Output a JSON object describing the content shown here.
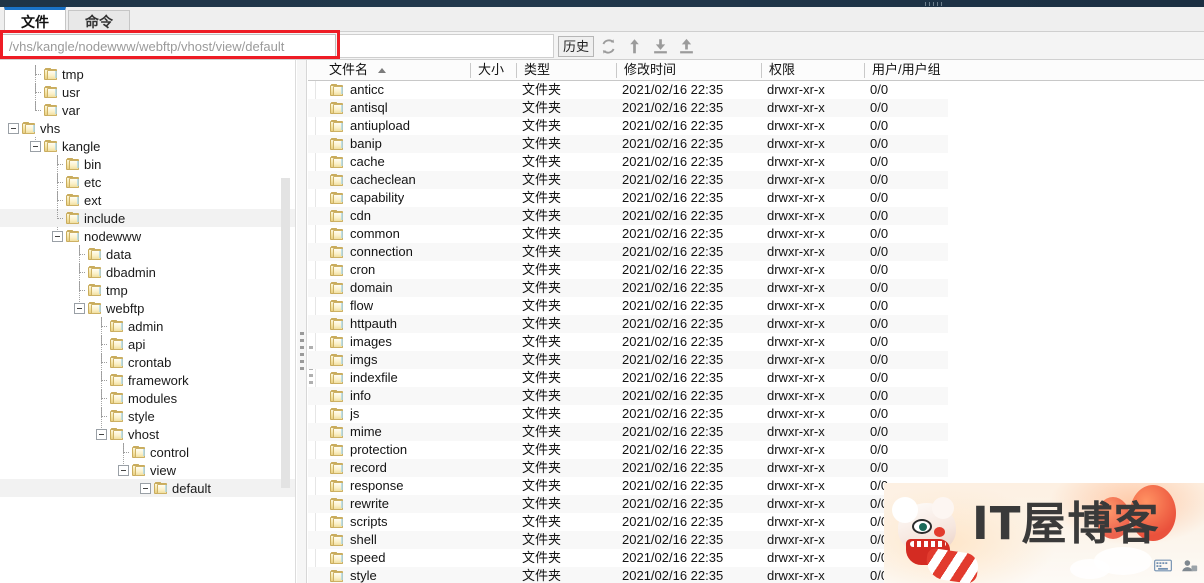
{
  "window": {
    "tabs": [
      {
        "label": "文件",
        "active": true,
        "name": "tab-files"
      },
      {
        "label": "命令",
        "active": false,
        "name": "tab-commands"
      }
    ]
  },
  "toolbar": {
    "path_value": "/vhs/kangle/nodewww/webftp/vhost/view/default",
    "path_placeholder": "/vhs/kangle/nodewww/webftp/vhost/view/default",
    "search_value": "",
    "history_label": "历史",
    "icons": [
      {
        "name": "refresh-icon",
        "title": "刷新"
      },
      {
        "name": "parent-directory-icon",
        "title": "上级目录"
      },
      {
        "name": "download-icon",
        "title": "下载"
      },
      {
        "name": "upload-icon",
        "title": "上传"
      }
    ],
    "highlight_color": "#ee1c25"
  },
  "tree": {
    "nodes": [
      {
        "label": "tmp",
        "depth": 1,
        "toggle": "none",
        "selected": false
      },
      {
        "label": "usr",
        "depth": 1,
        "toggle": "none",
        "selected": false
      },
      {
        "label": "var",
        "depth": 1,
        "toggle": "none",
        "selected": false
      },
      {
        "label": "vhs",
        "depth": 0,
        "toggle": "expanded",
        "selected": false
      },
      {
        "label": "kangle",
        "depth": 1,
        "toggle": "expanded",
        "selected": false
      },
      {
        "label": "bin",
        "depth": 2,
        "toggle": "none",
        "selected": false
      },
      {
        "label": "etc",
        "depth": 2,
        "toggle": "none",
        "selected": false
      },
      {
        "label": "ext",
        "depth": 2,
        "toggle": "none",
        "selected": false
      },
      {
        "label": "include",
        "depth": 2,
        "toggle": "none",
        "selected": true
      },
      {
        "label": "nodewww",
        "depth": 2,
        "toggle": "expanded",
        "selected": false
      },
      {
        "label": "data",
        "depth": 3,
        "toggle": "none",
        "selected": false
      },
      {
        "label": "dbadmin",
        "depth": 3,
        "toggle": "none",
        "selected": false
      },
      {
        "label": "tmp",
        "depth": 3,
        "toggle": "none",
        "selected": false
      },
      {
        "label": "webftp",
        "depth": 3,
        "toggle": "expanded",
        "selected": false
      },
      {
        "label": "admin",
        "depth": 4,
        "toggle": "none",
        "selected": false
      },
      {
        "label": "api",
        "depth": 4,
        "toggle": "none",
        "selected": false
      },
      {
        "label": "crontab",
        "depth": 4,
        "toggle": "none",
        "selected": false
      },
      {
        "label": "framework",
        "depth": 4,
        "toggle": "none",
        "selected": false
      },
      {
        "label": "modules",
        "depth": 4,
        "toggle": "none",
        "selected": false
      },
      {
        "label": "style",
        "depth": 4,
        "toggle": "none",
        "selected": false
      },
      {
        "label": "vhost",
        "depth": 4,
        "toggle": "expanded",
        "selected": false
      },
      {
        "label": "control",
        "depth": 5,
        "toggle": "none",
        "selected": false
      },
      {
        "label": "view",
        "depth": 5,
        "toggle": "expanded",
        "selected": false
      },
      {
        "label": "default",
        "depth": 6,
        "toggle": "expanded",
        "selected": true
      }
    ]
  },
  "list": {
    "columns": [
      {
        "key": "name",
        "label": "文件名",
        "sorted": true,
        "sort_dir": "asc"
      },
      {
        "key": "size",
        "label": "大小"
      },
      {
        "key": "type",
        "label": "类型"
      },
      {
        "key": "mtime",
        "label": "修改时间"
      },
      {
        "key": "perm",
        "label": "权限"
      },
      {
        "key": "owner",
        "label": "用户/用户组"
      }
    ],
    "rows": [
      {
        "name": "anticc",
        "size": "",
        "type": "文件夹",
        "mtime": "2021/02/16 22:35",
        "perm": "drwxr-xr-x",
        "owner": "0/0"
      },
      {
        "name": "antisql",
        "size": "",
        "type": "文件夹",
        "mtime": "2021/02/16 22:35",
        "perm": "drwxr-xr-x",
        "owner": "0/0"
      },
      {
        "name": "antiupload",
        "size": "",
        "type": "文件夹",
        "mtime": "2021/02/16 22:35",
        "perm": "drwxr-xr-x",
        "owner": "0/0"
      },
      {
        "name": "banip",
        "size": "",
        "type": "文件夹",
        "mtime": "2021/02/16 22:35",
        "perm": "drwxr-xr-x",
        "owner": "0/0"
      },
      {
        "name": "cache",
        "size": "",
        "type": "文件夹",
        "mtime": "2021/02/16 22:35",
        "perm": "drwxr-xr-x",
        "owner": "0/0"
      },
      {
        "name": "cacheclean",
        "size": "",
        "type": "文件夹",
        "mtime": "2021/02/16 22:35",
        "perm": "drwxr-xr-x",
        "owner": "0/0"
      },
      {
        "name": "capability",
        "size": "",
        "type": "文件夹",
        "mtime": "2021/02/16 22:35",
        "perm": "drwxr-xr-x",
        "owner": "0/0"
      },
      {
        "name": "cdn",
        "size": "",
        "type": "文件夹",
        "mtime": "2021/02/16 22:35",
        "perm": "drwxr-xr-x",
        "owner": "0/0"
      },
      {
        "name": "common",
        "size": "",
        "type": "文件夹",
        "mtime": "2021/02/16 22:35",
        "perm": "drwxr-xr-x",
        "owner": "0/0"
      },
      {
        "name": "connection",
        "size": "",
        "type": "文件夹",
        "mtime": "2021/02/16 22:35",
        "perm": "drwxr-xr-x",
        "owner": "0/0"
      },
      {
        "name": "cron",
        "size": "",
        "type": "文件夹",
        "mtime": "2021/02/16 22:35",
        "perm": "drwxr-xr-x",
        "owner": "0/0"
      },
      {
        "name": "domain",
        "size": "",
        "type": "文件夹",
        "mtime": "2021/02/16 22:35",
        "perm": "drwxr-xr-x",
        "owner": "0/0"
      },
      {
        "name": "flow",
        "size": "",
        "type": "文件夹",
        "mtime": "2021/02/16 22:35",
        "perm": "drwxr-xr-x",
        "owner": "0/0"
      },
      {
        "name": "httpauth",
        "size": "",
        "type": "文件夹",
        "mtime": "2021/02/16 22:35",
        "perm": "drwxr-xr-x",
        "owner": "0/0"
      },
      {
        "name": "images",
        "size": "",
        "type": "文件夹",
        "mtime": "2021/02/16 22:35",
        "perm": "drwxr-xr-x",
        "owner": "0/0"
      },
      {
        "name": "imgs",
        "size": "",
        "type": "文件夹",
        "mtime": "2021/02/16 22:35",
        "perm": "drwxr-xr-x",
        "owner": "0/0"
      },
      {
        "name": "indexfile",
        "size": "",
        "type": "文件夹",
        "mtime": "2021/02/16 22:35",
        "perm": "drwxr-xr-x",
        "owner": "0/0"
      },
      {
        "name": "info",
        "size": "",
        "type": "文件夹",
        "mtime": "2021/02/16 22:35",
        "perm": "drwxr-xr-x",
        "owner": "0/0"
      },
      {
        "name": "js",
        "size": "",
        "type": "文件夹",
        "mtime": "2021/02/16 22:35",
        "perm": "drwxr-xr-x",
        "owner": "0/0"
      },
      {
        "name": "mime",
        "size": "",
        "type": "文件夹",
        "mtime": "2021/02/16 22:35",
        "perm": "drwxr-xr-x",
        "owner": "0/0"
      },
      {
        "name": "protection",
        "size": "",
        "type": "文件夹",
        "mtime": "2021/02/16 22:35",
        "perm": "drwxr-xr-x",
        "owner": "0/0"
      },
      {
        "name": "record",
        "size": "",
        "type": "文件夹",
        "mtime": "2021/02/16 22:35",
        "perm": "drwxr-xr-x",
        "owner": "0/0"
      },
      {
        "name": "response",
        "size": "",
        "type": "文件夹",
        "mtime": "2021/02/16 22:35",
        "perm": "drwxr-xr-x",
        "owner": "0/0"
      },
      {
        "name": "rewrite",
        "size": "",
        "type": "文件夹",
        "mtime": "2021/02/16 22:35",
        "perm": "drwxr-xr-x",
        "owner": "0/0"
      },
      {
        "name": "scripts",
        "size": "",
        "type": "文件夹",
        "mtime": "2021/02/16 22:35",
        "perm": "drwxr-xr-x",
        "owner": "0/0"
      },
      {
        "name": "shell",
        "size": "",
        "type": "文件夹",
        "mtime": "2021/02/16 22:35",
        "perm": "drwxr-xr-x",
        "owner": "0/0"
      },
      {
        "name": "speed",
        "size": "",
        "type": "文件夹",
        "mtime": "2021/02/16 22:35",
        "perm": "drwxr-xr-x",
        "owner": "0/0"
      },
      {
        "name": "style",
        "size": "",
        "type": "文件夹",
        "mtime": "2021/02/16 22:35",
        "perm": "drwxr-xr-x",
        "owner": "0/0"
      }
    ]
  },
  "watermark": {
    "text": "IT屋博客"
  }
}
